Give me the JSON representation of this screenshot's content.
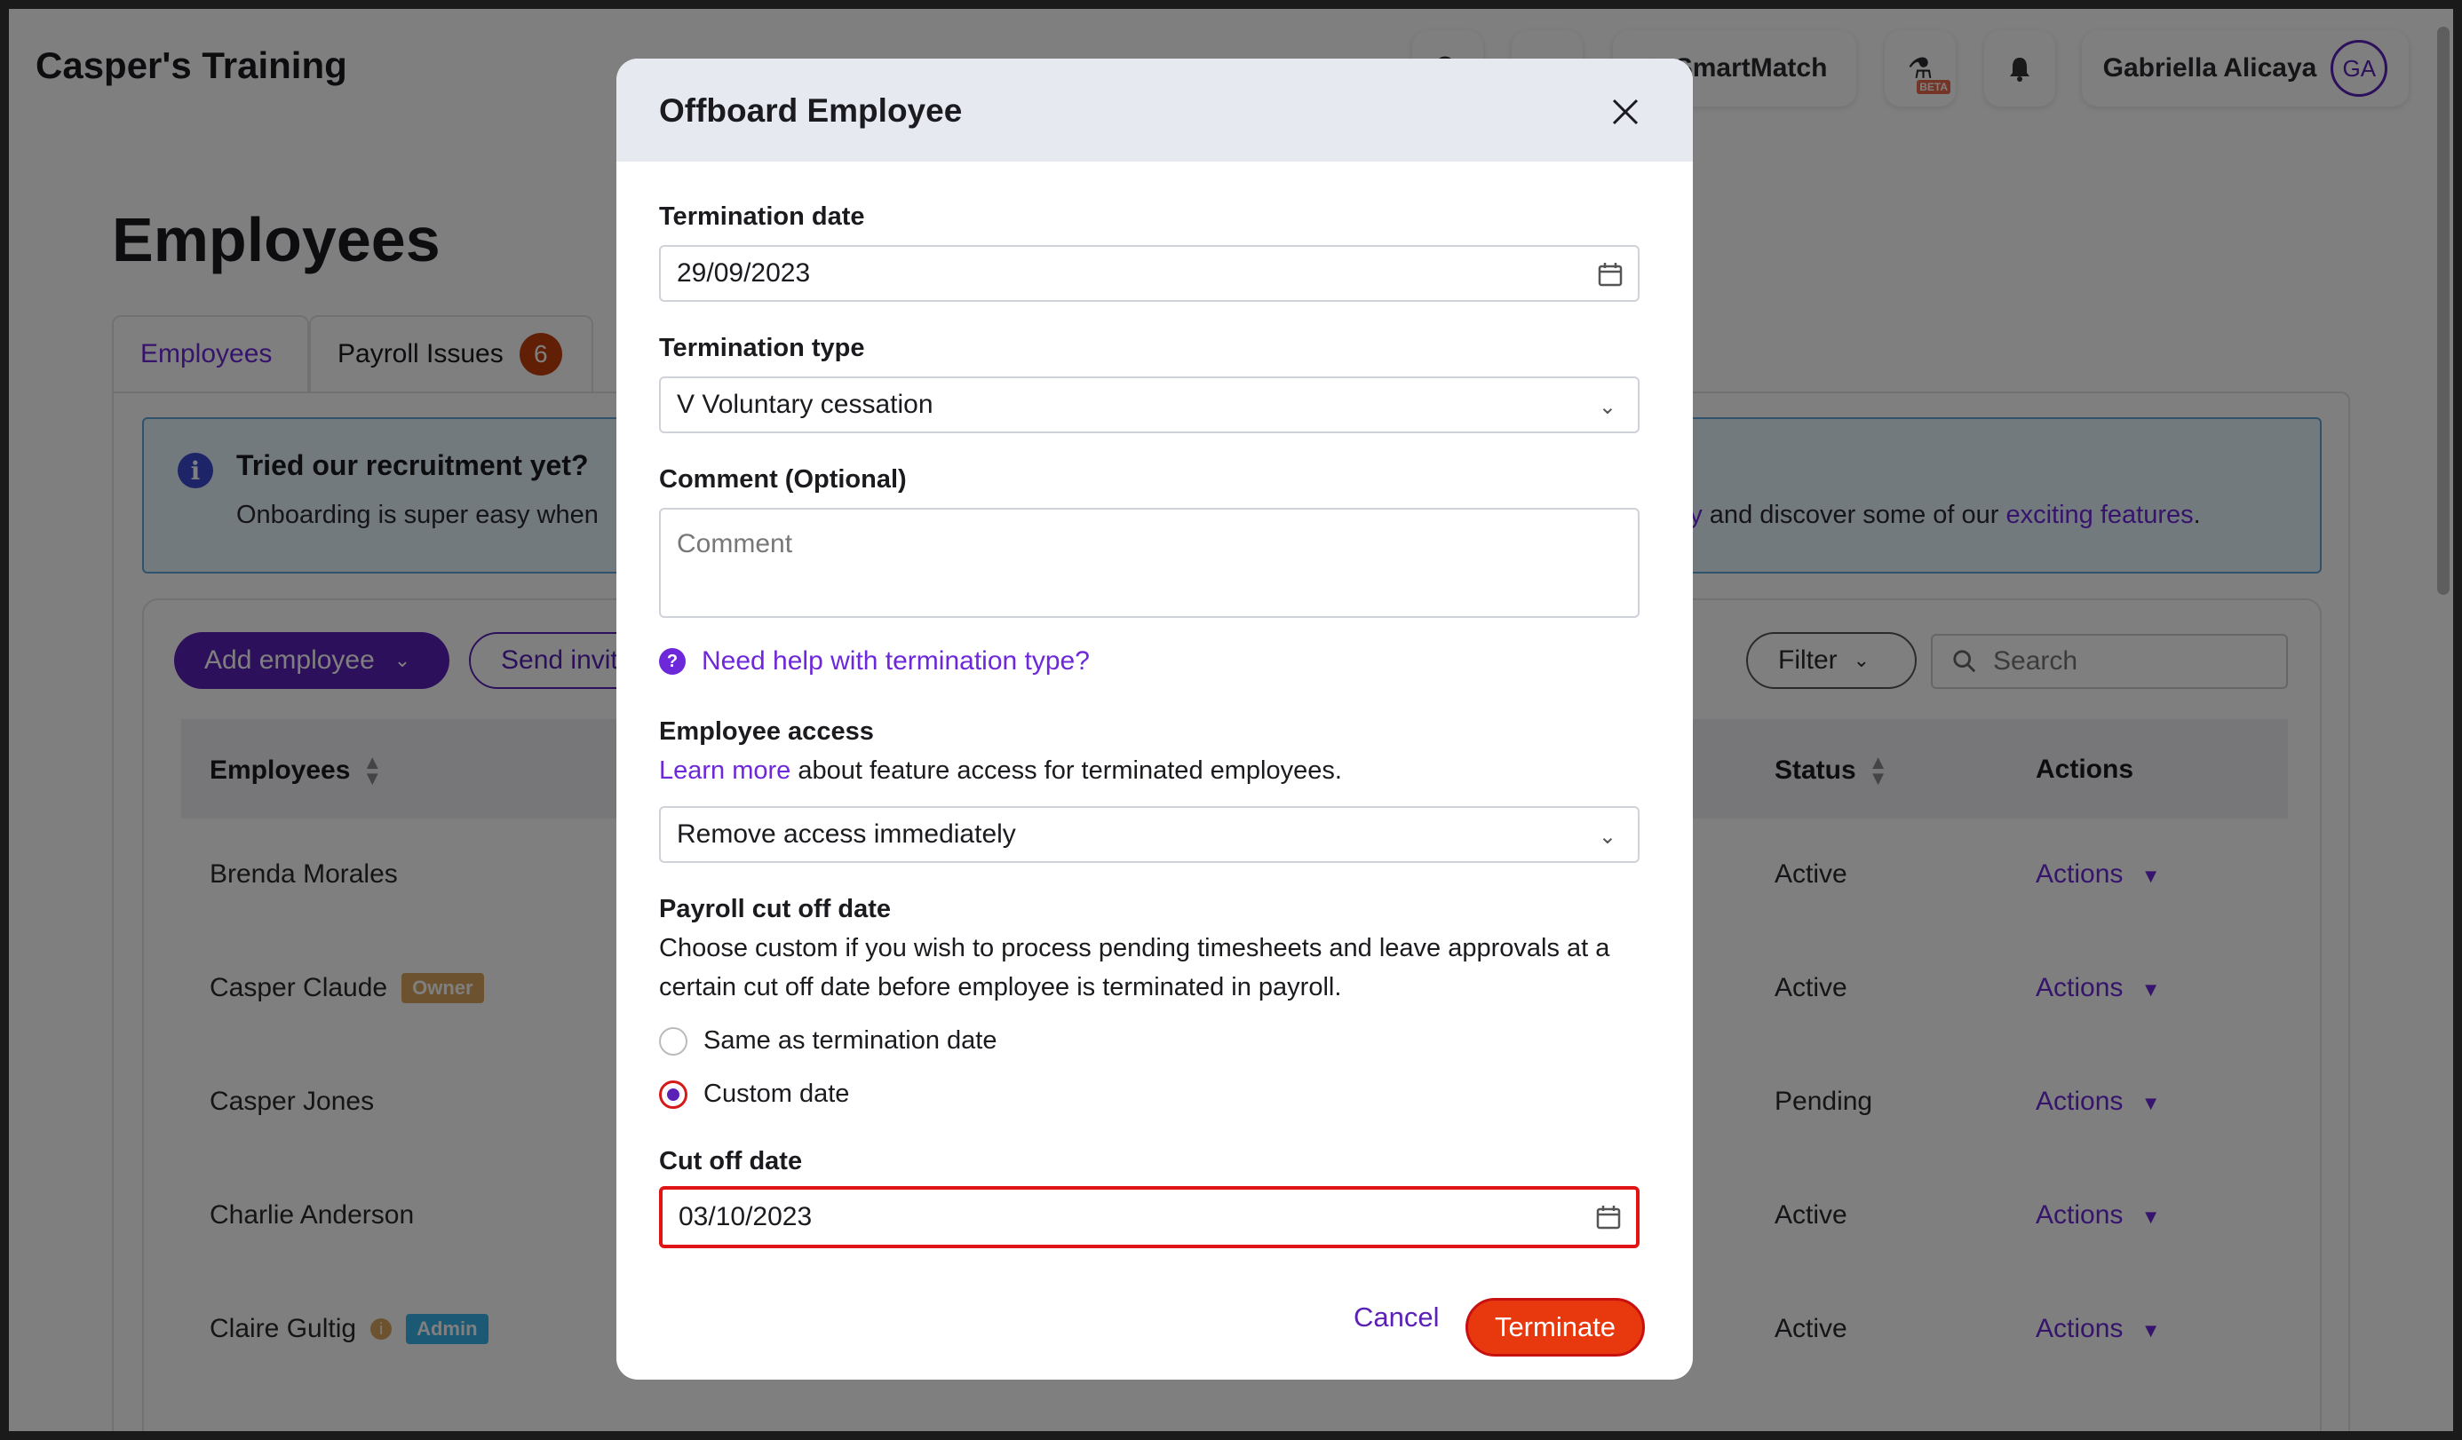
{
  "app": {
    "brand": "Casper's Training",
    "topbar": {
      "smartmatch_label": "SmartMatch",
      "beta_badge": "BETA",
      "user_name": "Gabriella Alicaya",
      "user_initials": "GA"
    },
    "page_title": "Employees",
    "tabs": [
      {
        "label": "Employees"
      },
      {
        "label": "Payroll Issues",
        "badge": "6"
      }
    ],
    "banner": {
      "title": "Tried our recruitment yet?",
      "text_start": "Onboarding is super easy when",
      "text_link1": "day",
      "text_middle": " and discover some of our ",
      "text_link2": "exciting features",
      "text_end": "."
    },
    "toolbar": {
      "add_employee": "Add employee",
      "send_invites": "Send invit",
      "filter": "Filter",
      "search_placeholder": "Search"
    },
    "table": {
      "headers": {
        "employees": "Employees",
        "status": "Status",
        "actions": "Actions"
      },
      "rows": [
        {
          "name": "Brenda Morales",
          "status": "Active",
          "actions": "Actions"
        },
        {
          "name": "Casper Claude",
          "tag": "Owner",
          "status": "Active",
          "actions": "Actions"
        },
        {
          "name": "Casper Jones",
          "status": "Pending",
          "actions": "Actions"
        },
        {
          "name": "Charlie Anderson",
          "status": "Active",
          "actions": "Actions"
        },
        {
          "name": "Claire Gultig",
          "tag": "Admin",
          "status": "Active",
          "actions": "Actions"
        }
      ]
    }
  },
  "modal": {
    "title": "Offboard Employee",
    "termination_date": {
      "label": "Termination date",
      "value": "29/09/2023"
    },
    "termination_type": {
      "label": "Termination type",
      "value": "V Voluntary cessation"
    },
    "comment": {
      "label": "Comment (Optional)",
      "placeholder": "Comment"
    },
    "help_link": "Need help with termination type?",
    "employee_access": {
      "label": "Employee access",
      "learn_more": "Learn more",
      "description": " about feature access for terminated employees.",
      "value": "Remove access immediately"
    },
    "payroll_cutoff": {
      "label": "Payroll cut off date",
      "description": "Choose custom if you wish to process pending timesheets and leave approvals at a certain cut off date before employee is terminated in payroll.",
      "option_same": "Same as termination date",
      "option_custom": "Custom date",
      "selected": "Custom date"
    },
    "cutoff_date": {
      "label": "Cut off date",
      "value": "03/10/2023"
    },
    "cancel": "Cancel",
    "terminate": "Terminate"
  },
  "colors": {
    "brand_purple": "#5b21b6",
    "danger": "#e8390e",
    "highlight_red": "#e01414",
    "banner_bg": "#e6f4fb"
  }
}
